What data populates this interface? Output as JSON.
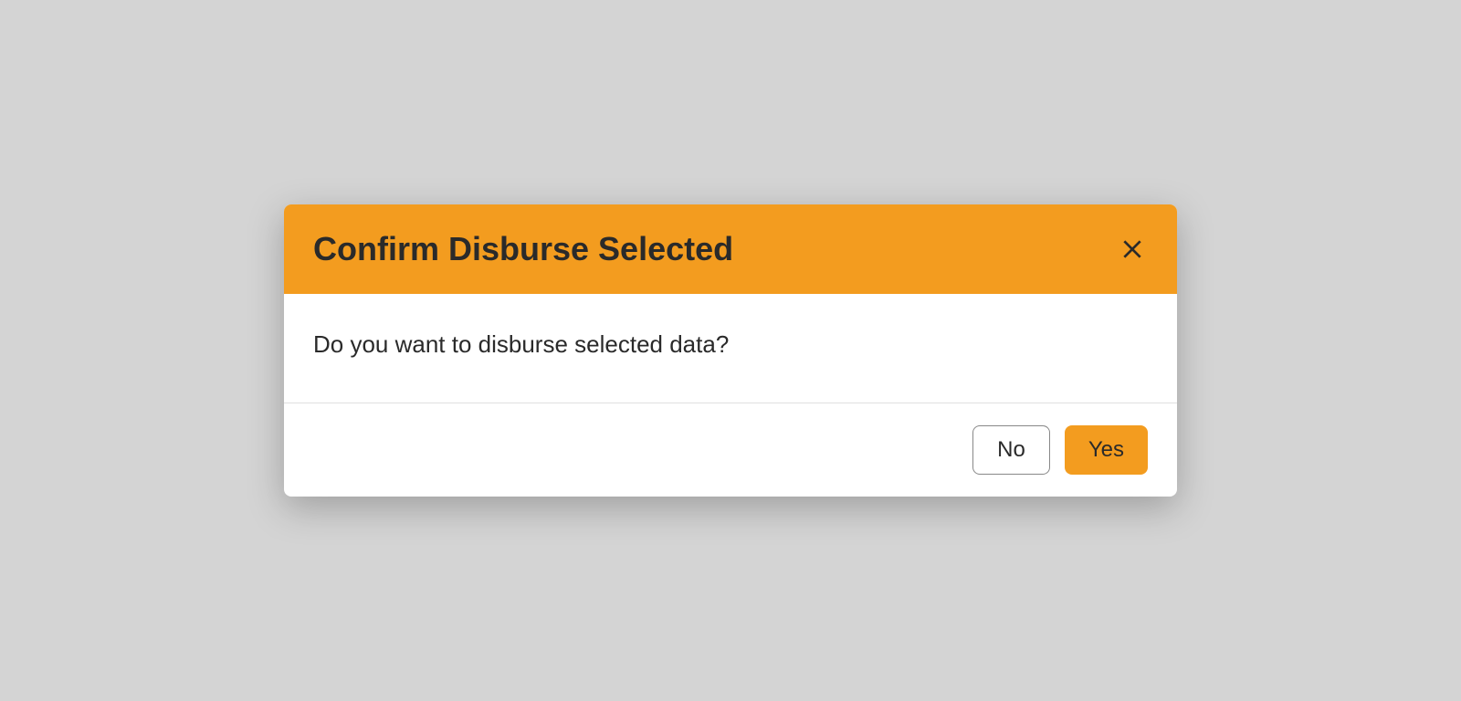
{
  "dialog": {
    "title": "Confirm Disburse Selected",
    "message": "Do you want to disburse selected data?",
    "buttons": {
      "no": "No",
      "yes": "Yes"
    }
  }
}
